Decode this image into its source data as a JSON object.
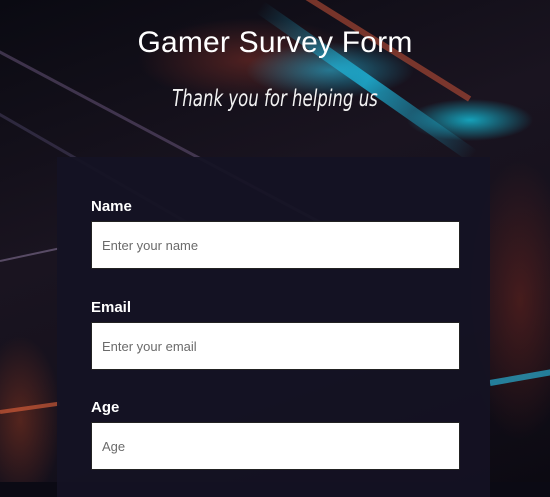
{
  "header": {
    "title": "Gamer Survey Form",
    "subtitle": "Thank you for helping us"
  },
  "form": {
    "fields": [
      {
        "label": "Name",
        "placeholder": "Enter your name",
        "value": ""
      },
      {
        "label": "Email",
        "placeholder": "Enter your email",
        "value": ""
      },
      {
        "label": "Age",
        "placeholder": "Age",
        "value": ""
      }
    ]
  }
}
